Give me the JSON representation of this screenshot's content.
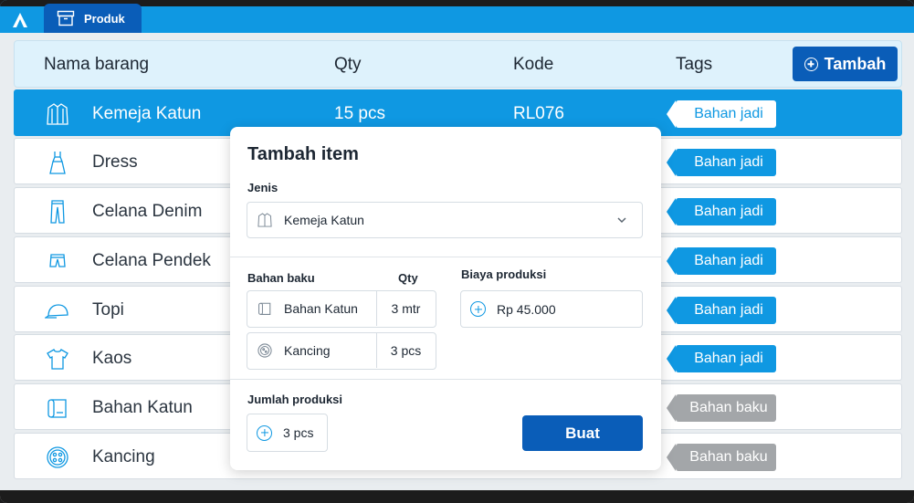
{
  "app": {
    "tab_label": "Produk"
  },
  "table": {
    "headers": {
      "name": "Nama barang",
      "qty": "Qty",
      "code": "Kode",
      "tags": "Tags"
    },
    "add_button": "Tambah",
    "rows": [
      {
        "icon": "shirt-icon",
        "name": "Kemeja Katun",
        "qty": "15 pcs",
        "code": "RL076",
        "tag": "Bahan jadi",
        "selected": true
      },
      {
        "icon": "dress-icon",
        "name": "Dress",
        "qty": "",
        "code": "",
        "tag": "Bahan jadi"
      },
      {
        "icon": "jeans-icon",
        "name": "Celana Denim",
        "qty": "",
        "code": "",
        "tag": "Bahan jadi"
      },
      {
        "icon": "shorts-icon",
        "name": "Celana Pendek",
        "qty": "",
        "code": "",
        "tag": "Bahan jadi"
      },
      {
        "icon": "cap-icon",
        "name": "Topi",
        "qty": "",
        "code": "",
        "tag": "Bahan jadi"
      },
      {
        "icon": "tshirt-icon",
        "name": "Kaos",
        "qty": "",
        "code": "",
        "tag": "Bahan jadi"
      },
      {
        "icon": "fabric-roll-icon",
        "name": "Bahan Katun",
        "qty": "",
        "code": "",
        "tag": "Bahan baku"
      },
      {
        "icon": "button-icon",
        "name": "Kancing",
        "qty": "",
        "code": "",
        "tag": "Bahan baku"
      }
    ]
  },
  "modal": {
    "title": "Tambah item",
    "jenis_label": "Jenis",
    "jenis_value": "Kemeja Katun",
    "bahan_label": "Bahan baku",
    "qty_label": "Qty",
    "biaya_label": "Biaya produksi",
    "biaya_value": "Rp 45.000",
    "materials": [
      {
        "icon": "fabric-roll-icon",
        "name": "Bahan Katun",
        "qty": "3 mtr"
      },
      {
        "icon": "button-icon",
        "name": "Kancing",
        "qty": "3 pcs"
      }
    ],
    "jumlah_label": "Jumlah produksi",
    "jumlah_value": "3 pcs",
    "submit_label": "Buat"
  },
  "colors": {
    "primary": "#0f98e2",
    "dark_primary": "#0a5db8",
    "muted_tag": "#a3a6a9"
  }
}
